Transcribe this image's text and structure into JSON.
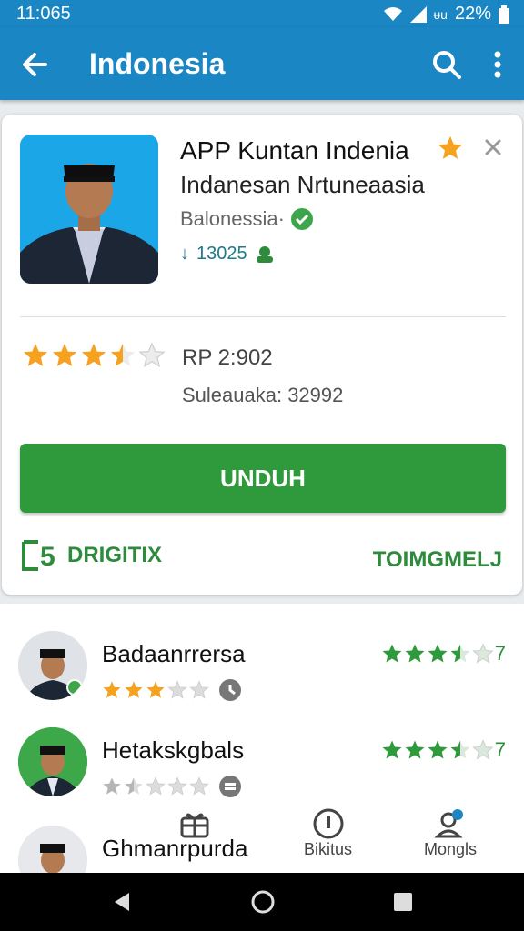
{
  "status": {
    "time": "11:065",
    "battery": "22%",
    "network": "ᵾu"
  },
  "app_bar": {
    "title": "Indonesia"
  },
  "app": {
    "name": "APP Kuntan Indenia",
    "subtitle": "Indanesan Nrtuneaasia",
    "developer": "Balonessia·",
    "installs": "13025",
    "price": "RP 2:902",
    "downloads": "Suleauaka: 32992",
    "rating": 3.5,
    "install_label": "UNDUH",
    "badge_left": "DRIGITIX",
    "badge_right": "TOIMGMELJ"
  },
  "reviews": [
    {
      "name": "Badaanrrersa",
      "stars": 3,
      "score_stars": 3.5,
      "score": "7"
    },
    {
      "name": "Hetakskgbals",
      "stars": 1.5,
      "score_stars": 3.5,
      "score": "7"
    },
    {
      "name": "Ghmanrpurda",
      "stars": 0,
      "score_stars": 0,
      "score": ""
    }
  ],
  "tabs": [
    {
      "label": "",
      "icon": "gift-icon"
    },
    {
      "label": "Bikitus",
      "icon": "info-circle-icon"
    },
    {
      "label": "Mongls",
      "icon": "user-badge-icon"
    }
  ],
  "colors": {
    "primary": "#1a86c4",
    "accent": "#2f9a3b",
    "star": "#f4a21f"
  }
}
